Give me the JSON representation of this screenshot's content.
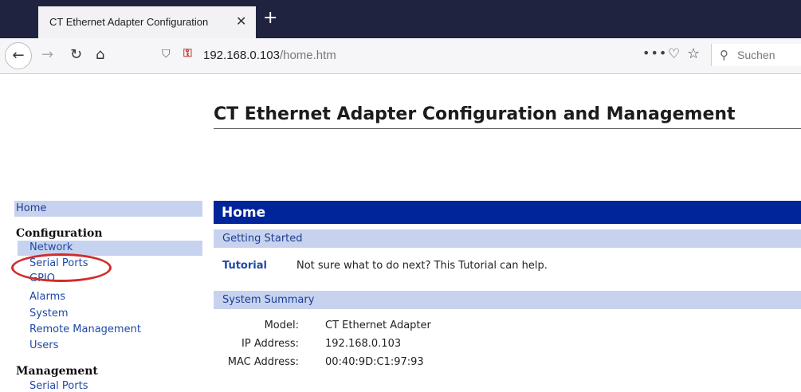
{
  "browser": {
    "tab_title": "CT Ethernet Adapter Configuration",
    "tab_close": "✕",
    "new_tab": "+",
    "url_host": "192.168.0.103",
    "url_path": "/home.htm",
    "search_placeholder": "Suchen"
  },
  "page": {
    "title": "CT Ethernet Adapter Configuration and Management"
  },
  "sidebar": {
    "home": "Home",
    "configuration_heading": "Configuration",
    "configuration_items": [
      "Network",
      "Serial Ports",
      "GPIO",
      "Alarms",
      "System",
      "Remote Management",
      "Users"
    ],
    "management_heading": "Management",
    "management_items": [
      "Serial Ports"
    ]
  },
  "main": {
    "heading": "Home",
    "getting_started": "Getting Started",
    "tutorial_link": "Tutorial",
    "tutorial_text": "Not sure what to do next? This Tutorial can help.",
    "system_summary": "System Summary",
    "summary": [
      {
        "label": "Model:",
        "value": "CT Ethernet Adapter"
      },
      {
        "label": "IP Address:",
        "value": "192.168.0.103"
      },
      {
        "label": "MAC Address:",
        "value": "00:40:9D:C1:97:93"
      }
    ]
  },
  "colors": {
    "header_bg": "#00249a",
    "section_bg": "#c7d3ee",
    "link": "#1f49a6",
    "annotation_circle": "#d12c2c"
  }
}
